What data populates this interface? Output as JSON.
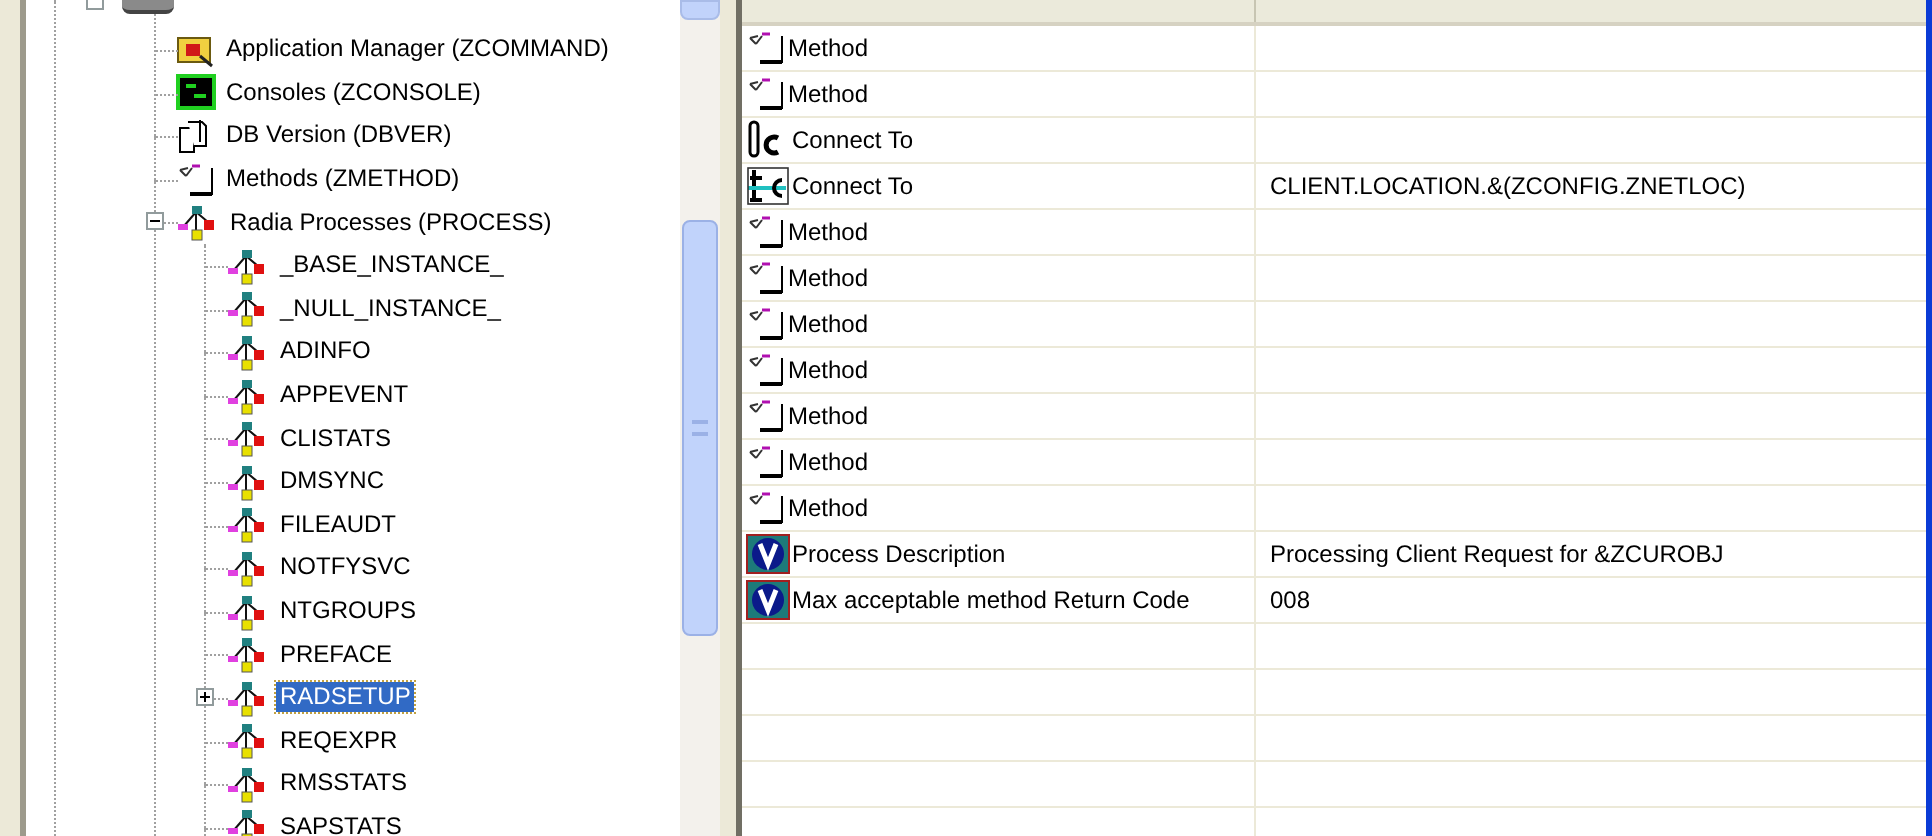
{
  "tree": {
    "items": [
      {
        "kind": "app-manager",
        "label": "Application Manager (ZCOMMAND)",
        "selected": false
      },
      {
        "kind": "console",
        "label": "Consoles (ZCONSOLE)",
        "selected": false
      },
      {
        "kind": "db",
        "label": "DB Version (DBVER)",
        "selected": false
      },
      {
        "kind": "method",
        "label": "Methods (ZMETHOD)",
        "selected": false
      },
      {
        "kind": "process",
        "label": "Radia Processes (PROCESS)",
        "selected": false,
        "expanded": true,
        "children": [
          {
            "kind": "process",
            "label": "_BASE_INSTANCE_",
            "selected": false
          },
          {
            "kind": "process",
            "label": "_NULL_INSTANCE_",
            "selected": false
          },
          {
            "kind": "process",
            "label": "ADINFO",
            "selected": false
          },
          {
            "kind": "process",
            "label": "APPEVENT",
            "selected": false
          },
          {
            "kind": "process",
            "label": "CLISTATS",
            "selected": false
          },
          {
            "kind": "process",
            "label": "DMSYNC",
            "selected": false
          },
          {
            "kind": "process",
            "label": "FILEAUDT",
            "selected": false
          },
          {
            "kind": "process",
            "label": "NOTFYSVC",
            "selected": false
          },
          {
            "kind": "process",
            "label": "NTGROUPS",
            "selected": false
          },
          {
            "kind": "process",
            "label": "PREFACE",
            "selected": false
          },
          {
            "kind": "process",
            "label": "RADSETUP",
            "selected": true,
            "expanded": false
          },
          {
            "kind": "process",
            "label": "REQEXPR",
            "selected": false
          },
          {
            "kind": "process",
            "label": "RMSSTATS",
            "selected": false
          },
          {
            "kind": "process",
            "label": "SAPSTATS",
            "selected": false
          }
        ]
      }
    ]
  },
  "attributes": {
    "rows": [
      {
        "kind": "method",
        "attribute": "Method",
        "value": ""
      },
      {
        "kind": "method",
        "attribute": "Method",
        "value": ""
      },
      {
        "kind": "connect",
        "attribute": "Connect To",
        "value": ""
      },
      {
        "kind": "connect-set",
        "attribute": "Connect To",
        "value": "CLIENT.LOCATION.&(ZCONFIG.ZNETLOC)"
      },
      {
        "kind": "method",
        "attribute": "Method",
        "value": ""
      },
      {
        "kind": "method",
        "attribute": "Method",
        "value": ""
      },
      {
        "kind": "method",
        "attribute": "Method",
        "value": ""
      },
      {
        "kind": "method",
        "attribute": "Method",
        "value": ""
      },
      {
        "kind": "method",
        "attribute": "Method",
        "value": ""
      },
      {
        "kind": "method",
        "attribute": "Method",
        "value": ""
      },
      {
        "kind": "method",
        "attribute": "Method",
        "value": ""
      },
      {
        "kind": "variable",
        "attribute": "Process Description",
        "value": "Processing Client Request for &ZCUROBJ"
      },
      {
        "kind": "variable",
        "attribute": "Max acceptable method Return Code",
        "value": "008"
      }
    ]
  }
}
